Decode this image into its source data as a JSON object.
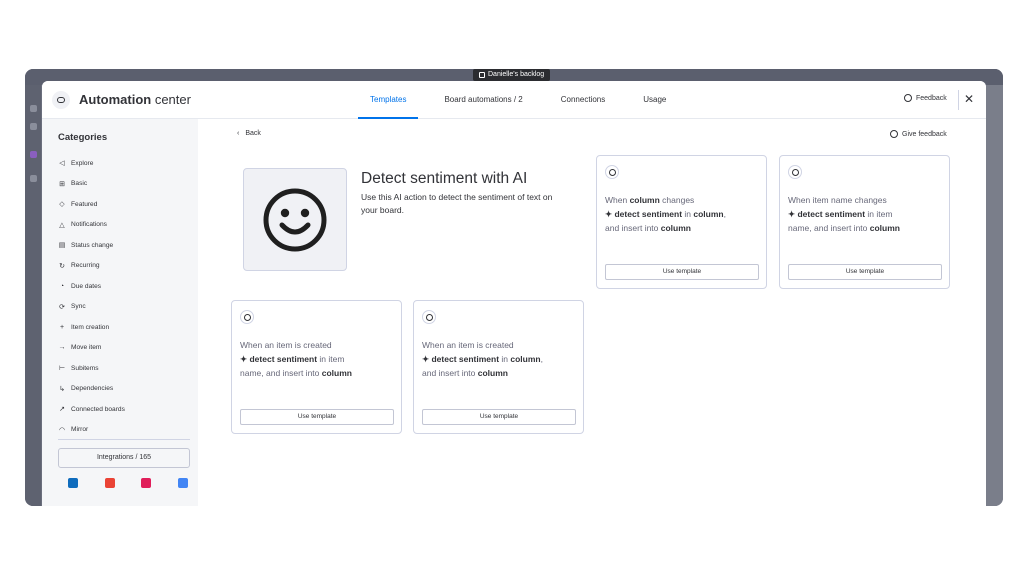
{
  "background_window": {
    "board_name": "Danielle's backlog"
  },
  "header": {
    "title_bold": "Automation",
    "title_rest": " center",
    "tabs": [
      {
        "label": "Templates",
        "active": true
      },
      {
        "label": "Board automations / 2",
        "active": false
      },
      {
        "label": "Connections",
        "active": false
      },
      {
        "label": "Usage",
        "active": false
      }
    ],
    "feedback_label": "Feedback",
    "close_icon": "close-icon"
  },
  "sidebar": {
    "title": "Categories",
    "items": [
      {
        "label": "Explore",
        "icon": "megaphone-icon"
      },
      {
        "label": "Basic",
        "icon": "blocks-icon"
      },
      {
        "label": "Featured",
        "icon": "diamond-icon"
      },
      {
        "label": "Notifications",
        "icon": "bell-icon"
      },
      {
        "label": "Status change",
        "icon": "status-icon"
      },
      {
        "label": "Recurring",
        "icon": "recurring-icon"
      },
      {
        "label": "Due dates",
        "icon": "alarm-icon"
      },
      {
        "label": "Sync",
        "icon": "sync-icon"
      },
      {
        "label": "Item creation",
        "icon": "plus-icon"
      },
      {
        "label": "Move item",
        "icon": "arrow-right-icon"
      },
      {
        "label": "Subitems",
        "icon": "subitems-icon"
      },
      {
        "label": "Dependencies",
        "icon": "dependency-icon"
      },
      {
        "label": "Connected boards",
        "icon": "arrow-diagonal-icon"
      },
      {
        "label": "Mirror",
        "icon": "mirror-icon"
      }
    ],
    "integrations_label": "Integrations / 165",
    "apps": [
      {
        "name": "outlook-icon",
        "color": "#0f6cbd"
      },
      {
        "name": "gmail-icon",
        "color": "#ea4335"
      },
      {
        "name": "slack-icon",
        "color": "#e01e5a"
      },
      {
        "name": "google-calendar-icon",
        "color": "#4285f4"
      }
    ]
  },
  "content": {
    "back_label": "Back",
    "give_feedback_label": "Give feedback",
    "hero": {
      "title": "Detect sentiment with AI",
      "description": "Use this AI action to detect the sentiment of text on your board.",
      "icon": "smiley-face-icon"
    },
    "cards": [
      {
        "line1_pre": "When ",
        "line1_bold": "column",
        "line1_post": " changes",
        "line2_spark": "✦ detect sentiment",
        "line2_mid": " in ",
        "line2_bold": "column",
        "line2_post": ",",
        "line3_pre": "and insert into ",
        "line3_bold": "column",
        "button": "Use template"
      },
      {
        "line1_pre": "When item name changes",
        "line1_bold": "",
        "line1_post": "",
        "line2_spark": "✦ detect sentiment",
        "line2_mid": " in item",
        "line2_bold": "",
        "line2_post": "",
        "line3_pre": "name, and insert into ",
        "line3_bold": "column",
        "button": "Use template"
      },
      {
        "line1_pre": "When an item is created",
        "line1_bold": "",
        "line1_post": "",
        "line2_spark": "✦ detect sentiment",
        "line2_mid": " in item",
        "line2_bold": "",
        "line2_post": "",
        "line3_pre": "name, and insert into ",
        "line3_bold": "column",
        "button": "Use template"
      },
      {
        "line1_pre": "When an item is created",
        "line1_bold": "",
        "line1_post": "",
        "line2_spark": "✦ detect sentiment",
        "line2_mid": " in ",
        "line2_bold": "column",
        "line2_post": ",",
        "line3_pre": "and insert into ",
        "line3_bold": "column",
        "button": "Use template"
      }
    ]
  },
  "colors": {
    "accent": "#0073ea",
    "text": "#323338",
    "muted": "#676879",
    "border": "#d0d4e4",
    "sidebar_bg": "#f5f6f8"
  }
}
